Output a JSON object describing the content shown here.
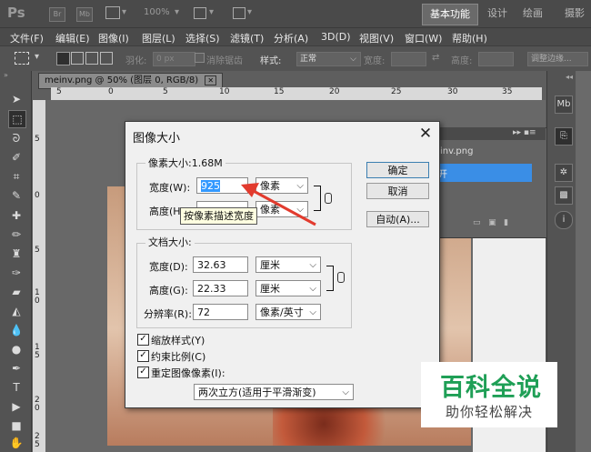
{
  "app": {
    "logo": "Ps",
    "bridge_label": "Br",
    "mini_label": "Mb",
    "zoom": "100%",
    "workspaces": [
      "基本功能",
      "设计",
      "绘画",
      "摄影"
    ]
  },
  "menubar": {
    "items": [
      "文件(F)",
      "编辑(E)",
      "图像(I)",
      "图层(L)",
      "选择(S)",
      "滤镜(T)",
      "分析(A)",
      "3D(D)",
      "视图(V)",
      "窗口(W)",
      "帮助(H)"
    ]
  },
  "options": {
    "feather_label": "羽化:",
    "feather_value": "0 px",
    "antialias_label": "消除锯齿",
    "style_label": "样式:",
    "style_value": "正常",
    "width_label": "宽度:",
    "height_label": "高度:",
    "refine_button": "调整边缘..."
  },
  "document": {
    "tab_title": "meinv.png @ 50% (图层 0, RGB/8)",
    "ruler_h_ticks": [
      "5",
      "0",
      "5",
      "10",
      "15",
      "20",
      "25",
      "30",
      "35"
    ],
    "ruler_v_ticks": [
      "5",
      "0",
      "5",
      "1 0",
      "1 5",
      "2 0",
      "2 5"
    ]
  },
  "layers_panel": {
    "tab_label": "inv.png",
    "selected_label": "开"
  },
  "dialog": {
    "title": "图像大小",
    "pixel_dims_label": "像素大小:1.68M",
    "width_label": "宽度(W):",
    "width_value": "925",
    "width_unit": "像素",
    "height_label": "高度(H):",
    "height_unit": "像素",
    "tooltip": "按像素描述宽度",
    "doc_size_label": "文档大小:",
    "doc_width_label": "宽度(D):",
    "doc_width_value": "32.63",
    "doc_width_unit": "厘米",
    "doc_height_label": "高度(G):",
    "doc_height_value": "22.33",
    "doc_height_unit": "厘米",
    "resolution_label": "分辨率(R):",
    "resolution_value": "72",
    "resolution_unit": "像素/英寸",
    "ok_button": "确定",
    "cancel_button": "取消",
    "auto_button": "自动(A)...",
    "scale_styles_label": "缩放样式(Y)",
    "constrain_label": "约束比例(C)",
    "resample_label": "重定图像像素(I):",
    "resample_method": "两次立方(适用于平滑渐变)",
    "scale_styles_checked": true,
    "constrain_checked": true,
    "resample_checked": true
  },
  "watermark": {
    "title": "百科全说",
    "subtitle": "助你轻松解决"
  },
  "colors": {
    "accent_arrow": "#e23b2e",
    "watermark_green": "#1f9f56",
    "selection_blue": "#3399ff"
  }
}
